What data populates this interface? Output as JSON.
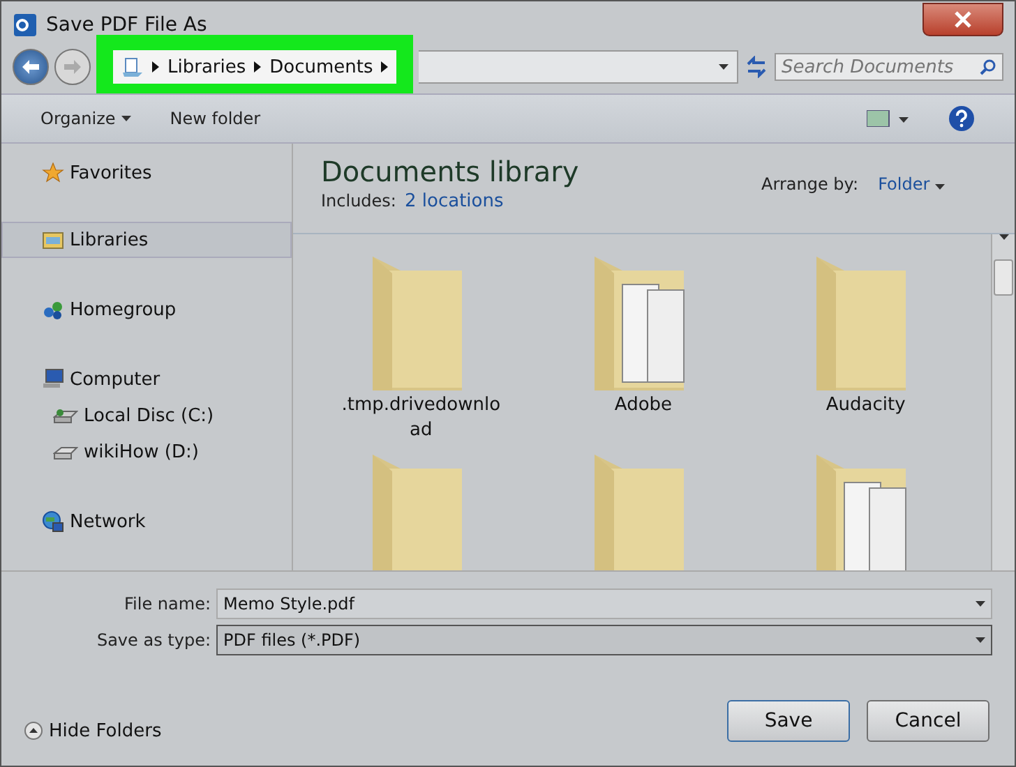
{
  "window": {
    "title": "Save PDF File As"
  },
  "address_bar": {
    "crumbs": [
      "Libraries",
      "Documents"
    ],
    "highlighted": true
  },
  "search": {
    "placeholder": "Search Documents"
  },
  "toolbar": {
    "organize": "Organize",
    "new_folder": "New folder"
  },
  "sidebar": {
    "items": [
      {
        "label": "Favorites",
        "selected": false
      },
      {
        "label": "Libraries",
        "selected": true
      },
      {
        "label": "Homegroup",
        "selected": false
      },
      {
        "label": "Computer",
        "selected": false,
        "children": [
          {
            "label": "Local Disc (C:)",
            "selected": false
          },
          {
            "label": "wikiHow (D:)",
            "selected": false
          }
        ]
      },
      {
        "label": "Network",
        "selected": false
      }
    ]
  },
  "library": {
    "title": "Documents library",
    "includes_label": "Includes:",
    "locations": "2 locations",
    "arrange_label": "Arrange by:",
    "arrange_value": "Folder"
  },
  "folders": [
    {
      "label": ".tmp.drivedownlo ad",
      "kind": "plain"
    },
    {
      "label": "Adobe",
      "kind": "documents"
    },
    {
      "label": "Audacity",
      "kind": "plain"
    },
    {
      "kind": "plain"
    },
    {
      "kind": "plain"
    },
    {
      "kind": "documents"
    }
  ],
  "file_name": {
    "label": "File name:",
    "value": "Memo Style.pdf"
  },
  "save_type": {
    "label": "Save as type:",
    "value": "PDF files (*.PDF)"
  },
  "hide_folders": "Hide Folders",
  "buttons": [
    {
      "label": "Save",
      "kind": "primary"
    },
    {
      "label": "Cancel",
      "kind": "normal"
    }
  ]
}
